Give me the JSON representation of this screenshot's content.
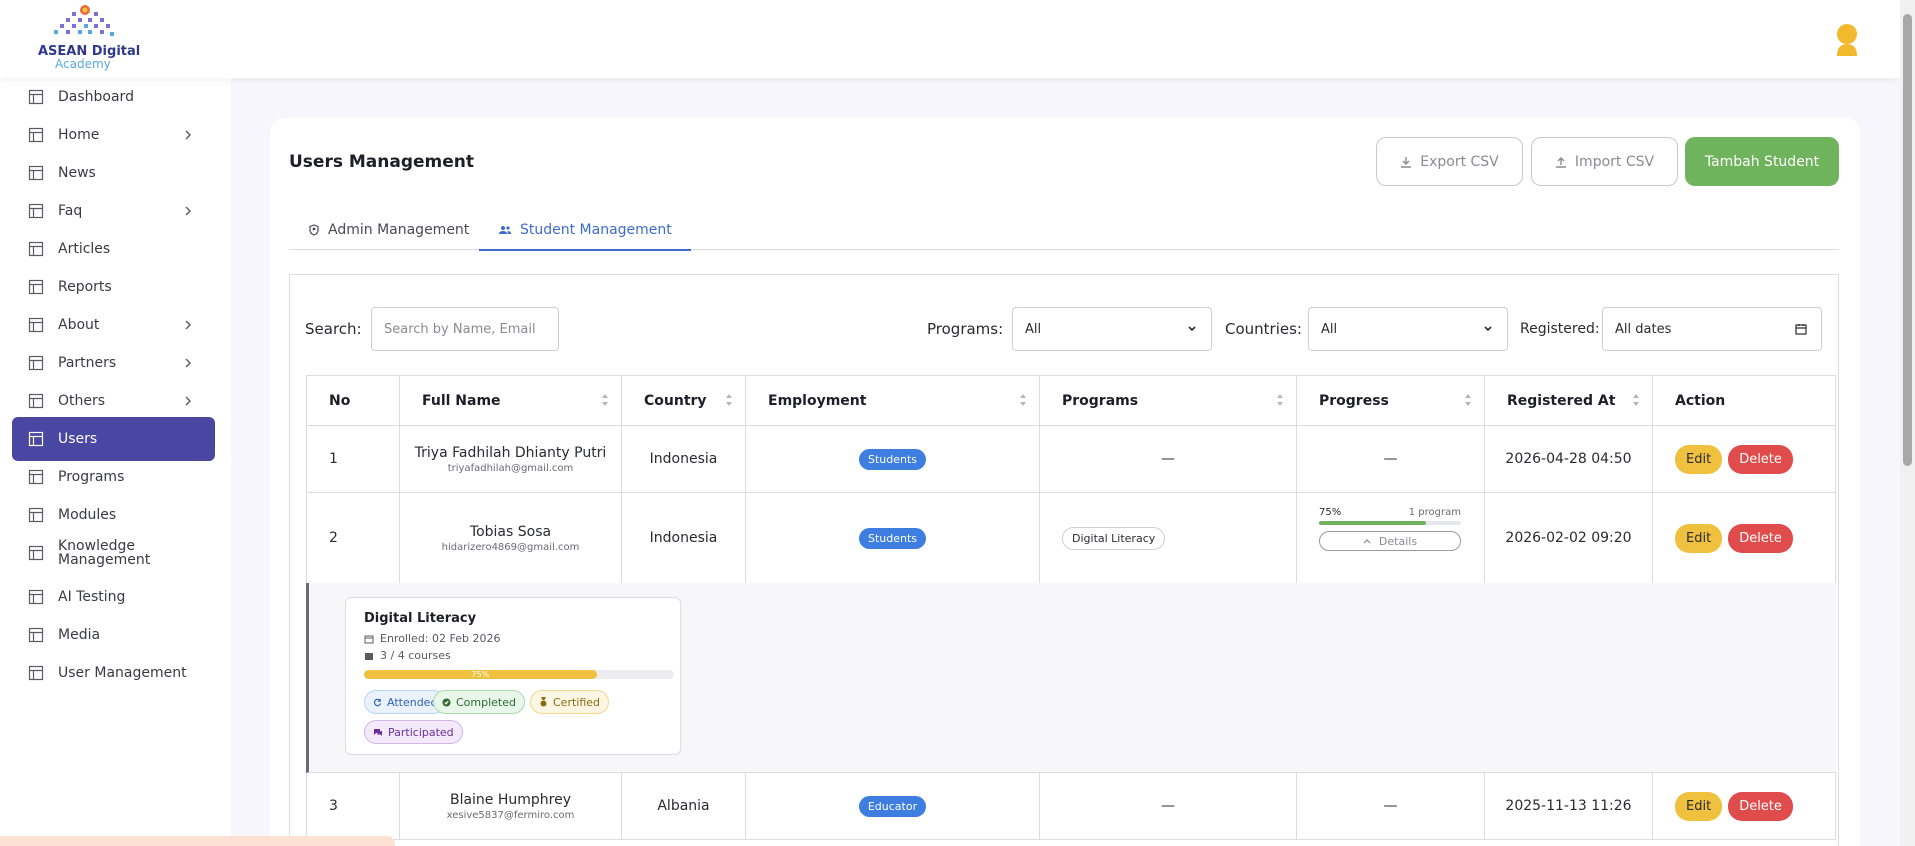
{
  "brand": {
    "line1": "ASEAN Digital",
    "line2": "Academy"
  },
  "sidebar": {
    "items": [
      {
        "label": "Dashboard",
        "has_chevron": false
      },
      {
        "label": "Home",
        "has_chevron": true
      },
      {
        "label": "News",
        "has_chevron": false
      },
      {
        "label": "Faq",
        "has_chevron": true
      },
      {
        "label": "Articles",
        "has_chevron": false
      },
      {
        "label": "Reports",
        "has_chevron": false
      },
      {
        "label": "About",
        "has_chevron": true
      },
      {
        "label": "Partners",
        "has_chevron": true
      },
      {
        "label": "Others",
        "has_chevron": true
      },
      {
        "label": "Users",
        "has_chevron": false,
        "active": true
      },
      {
        "label": "Programs",
        "has_chevron": false
      },
      {
        "label": "Modules",
        "has_chevron": false
      },
      {
        "label": "Knowledge Management",
        "has_chevron": false
      },
      {
        "label": "AI Testing",
        "has_chevron": false
      },
      {
        "label": "Media",
        "has_chevron": false
      },
      {
        "label": "User Management",
        "has_chevron": false
      }
    ]
  },
  "page": {
    "title": "Users Management",
    "export_label": "Export CSV",
    "import_label": "Import CSV",
    "add_label": "Tambah Student"
  },
  "tabs": {
    "admin": "Admin Management",
    "student": "Student Management"
  },
  "filters": {
    "search_label": "Search:",
    "search_placeholder": "Search by Name, Email",
    "programs_label": "Programs:",
    "programs_value": "All",
    "countries_label": "Countries:",
    "countries_value": "All",
    "registered_label": "Registered:",
    "registered_value": "All dates"
  },
  "table": {
    "headers": {
      "no": "No",
      "name": "Full Name",
      "country": "Country",
      "employment": "Employment",
      "programs": "Programs",
      "progress": "Progress",
      "registered": "Registered At",
      "action": "Action"
    },
    "edit_label": "Edit",
    "delete_label": "Delete",
    "dash": "—",
    "rows": [
      {
        "no": "1",
        "name": "Triya Fadhilah Dhianty Putri",
        "email": "triyafadhilah@gmail.com",
        "country": "Indonesia",
        "employment": "Students",
        "programs": "—",
        "progress": "—",
        "registered": "2026-04-28 04:50"
      },
      {
        "no": "2",
        "name": "Tobias Sosa",
        "email": "hidarizero4869@gmail.com",
        "country": "Indonesia",
        "employment": "Students",
        "programs": "Digital Literacy",
        "progress_pct_label": "75%",
        "progress_pct": 75,
        "progress_count": "1 program",
        "details_label": "Details",
        "registered": "2026-02-02 09:20"
      },
      {
        "no": "3",
        "name": "Blaine Humphrey",
        "email": "xesive5837@fermiro.com",
        "country": "Albania",
        "employment": "Educator",
        "programs": "—",
        "progress": "—",
        "registered": "2025-11-13 11:26"
      }
    ],
    "expanded": {
      "program": "Digital Literacy",
      "enrolled": "Enrolled: 02 Feb 2026",
      "courses": "3 / 4 courses",
      "progress_label": "75%",
      "progress_pct": 75,
      "tags": {
        "attended": "Attended",
        "completed": "Completed",
        "certified": "Certified",
        "participated": "Participated"
      }
    }
  },
  "colors": {
    "primary": "#4a47a3",
    "green": "#6fb35d",
    "blue": "#3d7ee0",
    "yellow": "#f0c13e",
    "red": "#e04b4b",
    "link": "#3f6bd1"
  }
}
